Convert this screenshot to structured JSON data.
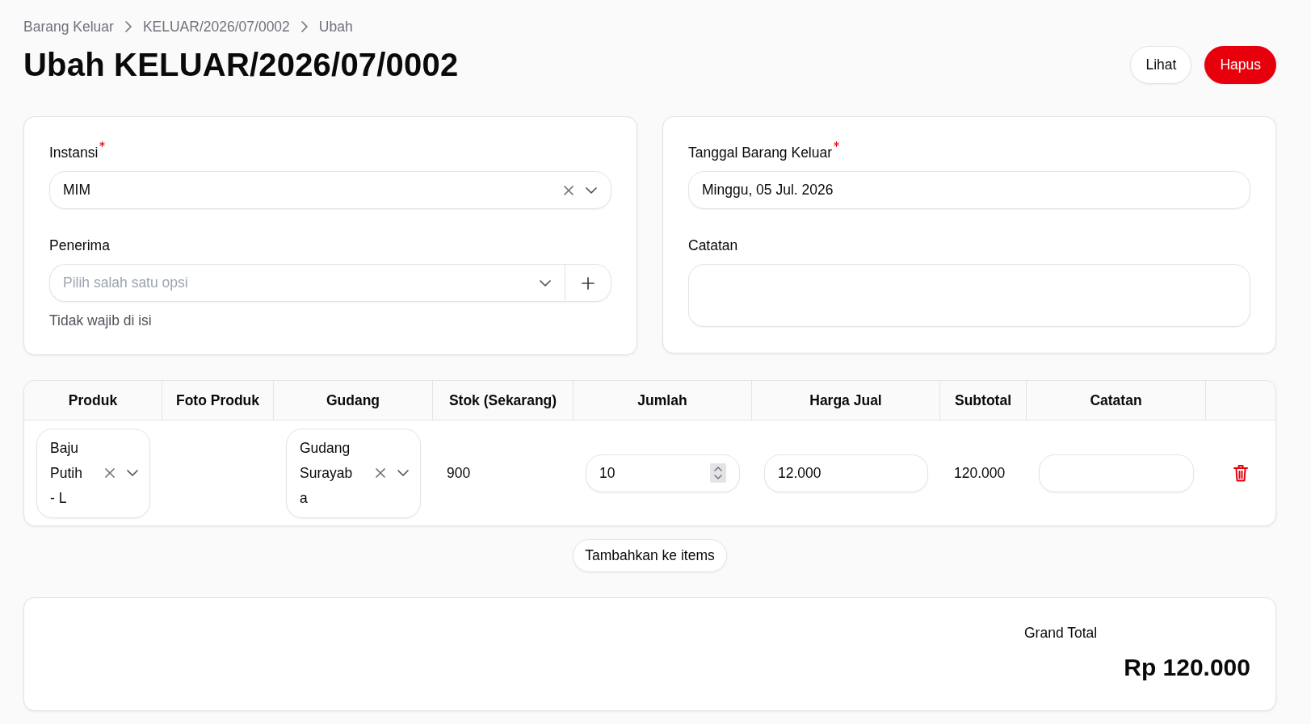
{
  "breadcrumbs": [
    {
      "label": "Barang Keluar"
    },
    {
      "label": "KELUAR/2026/07/0002"
    },
    {
      "label": "Ubah"
    }
  ],
  "title": "Ubah KELUAR/2026/07/0002",
  "actions": [
    {
      "label": "Lihat",
      "kind": "outline"
    },
    {
      "label": "Hapus",
      "kind": "danger"
    }
  ],
  "form_cards": [
    {
      "fields": [
        {
          "label": "Instansi",
          "required": true,
          "kind": "select",
          "value": "MIM"
        },
        {
          "label": "Penerima",
          "required": false,
          "kind": "select_create",
          "placeholder": "Pilih salah satu opsi",
          "helper": "Tidak wajib di isi"
        }
      ]
    },
    {
      "fields": [
        {
          "label": "Tanggal Barang Keluar",
          "required": true,
          "kind": "date",
          "value": "Minggu, 05 Jul. 2026"
        },
        {
          "label": "Catatan",
          "required": false,
          "kind": "textarea"
        }
      ]
    }
  ],
  "items_table": {
    "columns": [
      "Produk",
      "Foto Produk",
      "Gudang",
      "Stok (Sekarang)",
      "Jumlah",
      "Harga Jual",
      "Subtotal",
      "Catatan"
    ],
    "rows": [
      {
        "cells": [
          {
            "kind": "select",
            "value": "Baju Putih - L"
          },
          {
            "kind": "blank"
          },
          {
            "kind": "select",
            "value": "Gudang Surayaba"
          },
          {
            "kind": "text",
            "value": "900"
          },
          {
            "kind": "number",
            "value": "10"
          },
          {
            "kind": "input",
            "value": "12.000"
          },
          {
            "kind": "text",
            "value": "120.000"
          },
          {
            "kind": "input"
          },
          {
            "kind": "delete"
          }
        ]
      }
    ]
  },
  "add_button": "Tambahkan ke items",
  "summary": {
    "label": "Grand Total",
    "value": "Rp 120.000"
  }
}
